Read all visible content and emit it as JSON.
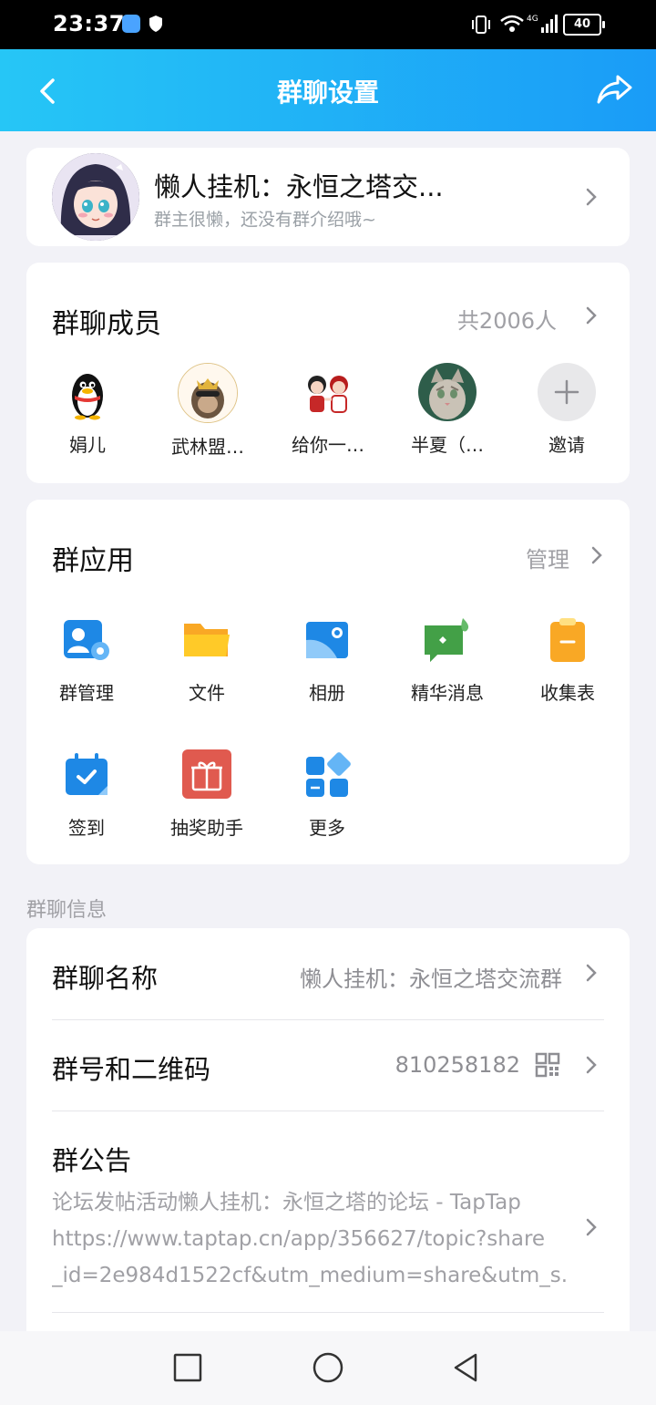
{
  "status": {
    "time": "23:37",
    "battery": "40"
  },
  "header": {
    "title": "群聊设置"
  },
  "group": {
    "name": "懒人挂机：永恒之塔交...",
    "description": "群主很懒，还没有群介绍哦~"
  },
  "members": {
    "title": "群聊成员",
    "count_label": "共2006人",
    "list": [
      {
        "name": "娟儿"
      },
      {
        "name": "武林盟…"
      },
      {
        "name": "给你一…"
      },
      {
        "name": "半夏（…"
      },
      {
        "name": "邀请"
      }
    ]
  },
  "apps": {
    "title": "群应用",
    "manage_label": "管理",
    "list": [
      {
        "label": "群管理",
        "icon": "group-admin-icon"
      },
      {
        "label": "文件",
        "icon": "folder-icon"
      },
      {
        "label": "相册",
        "icon": "album-icon"
      },
      {
        "label": "精华消息",
        "icon": "highlight-message-icon"
      },
      {
        "label": "收集表",
        "icon": "clipboard-icon"
      },
      {
        "label": "签到",
        "icon": "calendar-check-icon"
      },
      {
        "label": "抽奖助手",
        "icon": "gift-icon"
      },
      {
        "label": "更多",
        "icon": "more-apps-icon"
      }
    ]
  },
  "info": {
    "section_label": "群聊信息",
    "name_row": {
      "title": "群聊名称",
      "value": "懒人挂机：永恒之塔交流群"
    },
    "id_row": {
      "title": "群号和二维码",
      "value": "810258182"
    },
    "notice_row": {
      "title": "群公告",
      "lines": [
        "论坛发帖活动懒人挂机：永恒之塔的论坛 - TapTap",
        "https://www.taptap.cn/app/356627/topic?share",
        "_id=2e984d1522cf&utm_medium=share&utm_s..."
      ]
    }
  },
  "colors": {
    "header_start": "#26c6f6",
    "header_end": "#1a9cf7",
    "background": "#f2f2f7"
  }
}
